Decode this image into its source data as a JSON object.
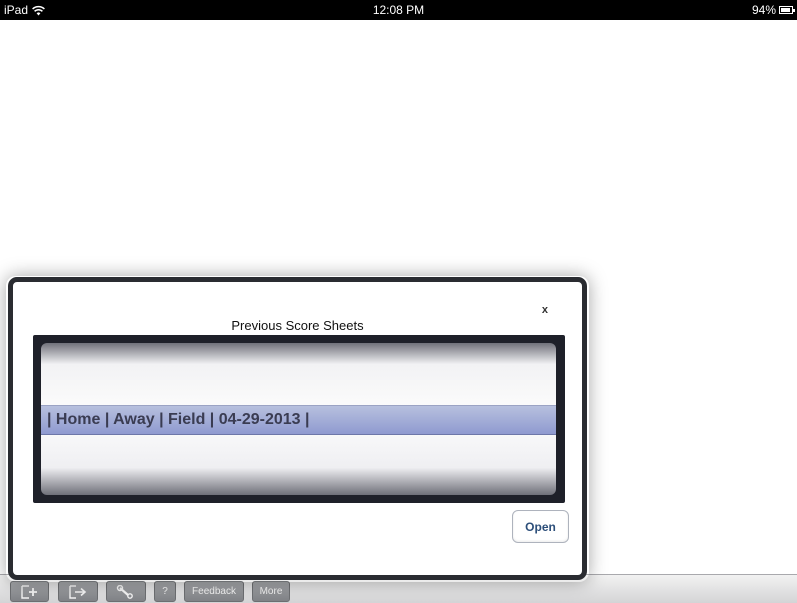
{
  "status_bar": {
    "device": "iPad",
    "time": "12:08 PM",
    "battery_text": "94%",
    "battery_level_fraction": 0.94
  },
  "dialog": {
    "title": "Previous Score Sheets",
    "close_label": "x",
    "open_label": "Open",
    "picker": {
      "selected_row": "| Home | Away | Field | 04-29-2013 |",
      "rows": [
        "| Home | Away | Field | 04-29-2013 |"
      ]
    }
  },
  "toolbar": {
    "buttons": [
      {
        "name": "new-sheet",
        "icon": "new-document-plus-icon",
        "label": ""
      },
      {
        "name": "export",
        "icon": "export-arrow-icon",
        "label": ""
      },
      {
        "name": "settings",
        "icon": "wrench-icon",
        "label": ""
      },
      {
        "name": "help",
        "icon": "",
        "label": "?"
      },
      {
        "name": "feedback",
        "icon": "",
        "label": "Feedback"
      },
      {
        "name": "more",
        "icon": "",
        "label": "More"
      }
    ]
  },
  "colors": {
    "status_bar_bg": "#000000",
    "dialog_border": "#2a2c31",
    "picker_selection": "#9aa4d4",
    "open_button_text": "#2d4f7a",
    "toolbar_button": "#939599"
  }
}
